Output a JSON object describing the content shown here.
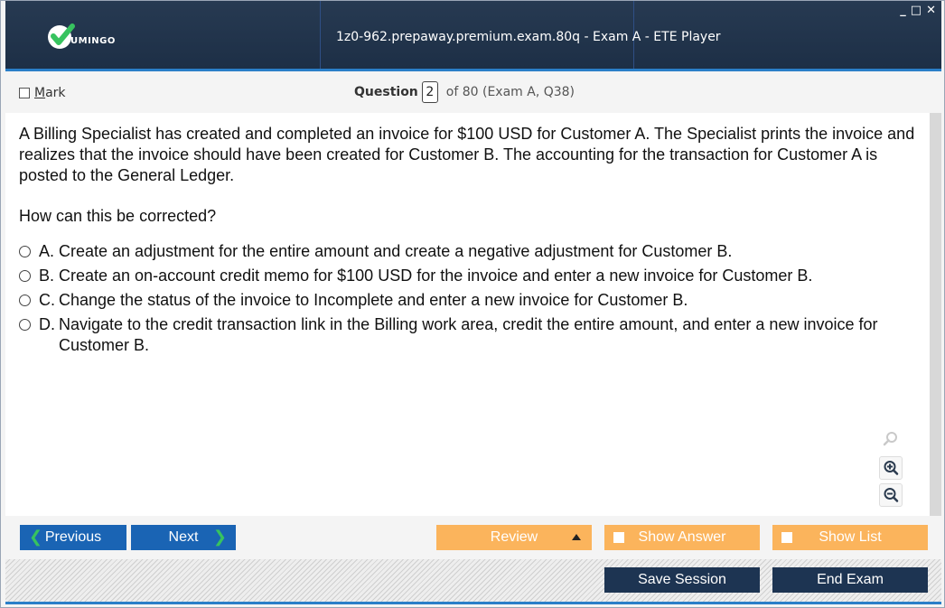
{
  "titlebar": {
    "logo_text": "UMINGO",
    "title": "1z0-962.prepaway.premium.exam.80q - Exam A - ETE Player",
    "controls": {
      "minimize": "_",
      "maximize": "□",
      "close": "✕"
    }
  },
  "question_header": {
    "mark_label": "Mark",
    "question_label": "Question",
    "question_number": "2",
    "of_text": "of 80 (Exam A, Q38)"
  },
  "question": {
    "text": "A Billing Specialist has created and completed an invoice for $100 USD for Customer A. The Specialist prints the invoice and realizes that the invoice should have been created for Customer B. The accounting for the transaction for Customer A is posted to the General Ledger.",
    "prompt": "How can this be corrected?",
    "options": [
      {
        "letter": "A.",
        "text": "Create an adjustment for the entire amount and create a negative adjustment for Customer B."
      },
      {
        "letter": "B.",
        "text": "Create an on-account credit memo for $100 USD for the invoice and enter a new invoice for Customer B."
      },
      {
        "letter": "C.",
        "text": "Change the status of the invoice to Incomplete and enter a new invoice for Customer B."
      },
      {
        "letter": "D.",
        "text": "Navigate to the credit transaction link in the Billing work area, credit the entire amount, and enter a new invoice for Customer B."
      }
    ]
  },
  "zoom": {
    "icons": [
      "search-icon",
      "zoom-in-icon",
      "zoom-out-icon"
    ]
  },
  "nav": {
    "previous": "Previous",
    "next": "Next",
    "review": "Review",
    "show_answer": "Show Answer",
    "show_list": "Show List"
  },
  "footer": {
    "save_session": "Save Session",
    "end_exam": "End Exam"
  },
  "colors": {
    "titlebar": "#1d2f46",
    "accent_blue": "#2a7fc8",
    "nav_blue": "#1a64b4",
    "orange": "#fbb45c",
    "dark_navy": "#1d3452",
    "logo_green": "#37c35f"
  }
}
